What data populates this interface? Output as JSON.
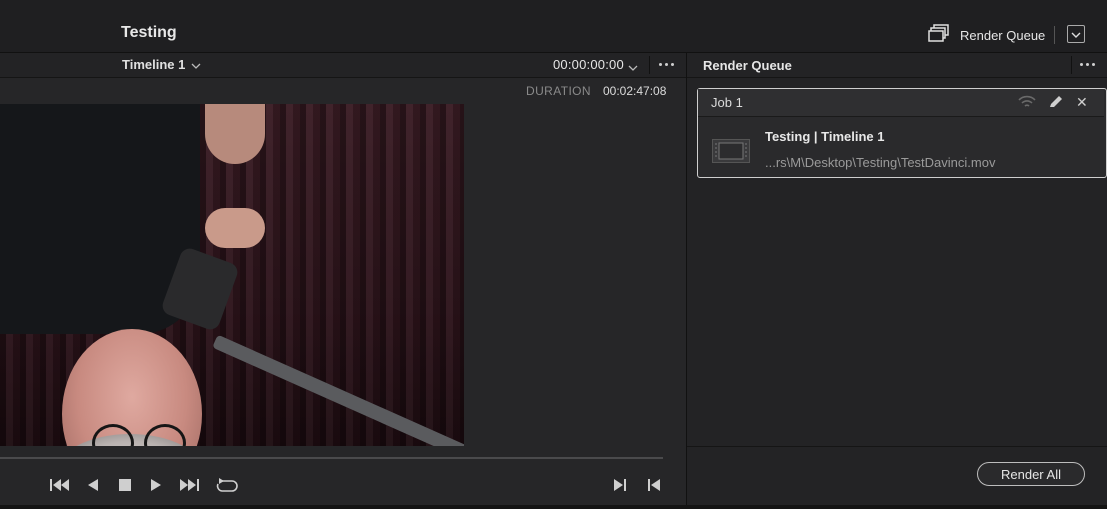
{
  "project": {
    "title": "Testing"
  },
  "topbar": {
    "render_queue_label": "Render Queue"
  },
  "viewer": {
    "timeline_name": "Timeline 1",
    "timecode": "00:00:00:00",
    "duration_label": "DURATION",
    "duration_value": "00:02:47:08"
  },
  "render_queue": {
    "title": "Render Queue",
    "jobs": [
      {
        "title": "Job 1",
        "name": "Testing | Timeline 1",
        "path": "...rs\\M\\Desktop\\Testing\\TestDavinci.mov"
      }
    ],
    "render_all_label": "Render All"
  },
  "icons": {
    "render_queue": "render-queue-icon",
    "expand": "chevron-down-icon",
    "more": "more-dots-icon",
    "wifi": "remote-render-icon",
    "edit": "pencil-icon",
    "close": "close-icon",
    "thumbnail": "film-icon"
  },
  "colors": {
    "background": "#1f1f21",
    "panel": "#232325",
    "text": "#e6e6e6",
    "muted": "#9a9a9a"
  }
}
